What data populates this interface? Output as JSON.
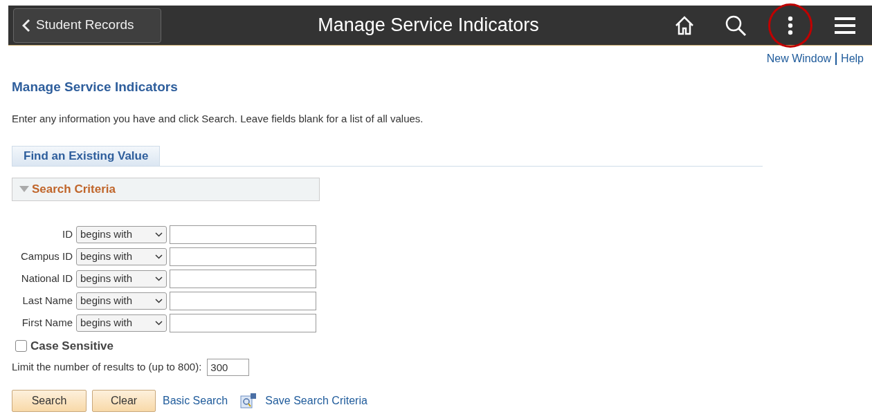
{
  "header": {
    "back_button": "Student Records",
    "title": "Manage Service Indicators",
    "more_highlighted": true
  },
  "top_links": [
    "New Window",
    "Help"
  ],
  "page_title": "Manage Service Indicators",
  "instructions": "Enter any information you have and click Search. Leave fields blank for a list of all values.",
  "tabs": [
    {
      "label": "Find an Existing Value",
      "selected": true
    }
  ],
  "search_criteria": {
    "title": "Search Criteria",
    "expanded": true
  },
  "fields": [
    {
      "label": "ID",
      "operator": "begins with"
    },
    {
      "label": "Campus ID",
      "operator": "begins with"
    },
    {
      "label": "National ID",
      "operator": "begins with"
    },
    {
      "label": "Last Name",
      "operator": "begins with"
    },
    {
      "label": "First Name",
      "operator": "begins with"
    }
  ],
  "case_sensitive": {
    "label": "Case Sensitive",
    "checked": false
  },
  "limit": {
    "label": "Limit the number of results to (up to 800):",
    "value": "300"
  },
  "buttons": [
    "Search",
    "Clear"
  ],
  "links": [
    "Basic Search",
    "Save Search Criteria"
  ]
}
